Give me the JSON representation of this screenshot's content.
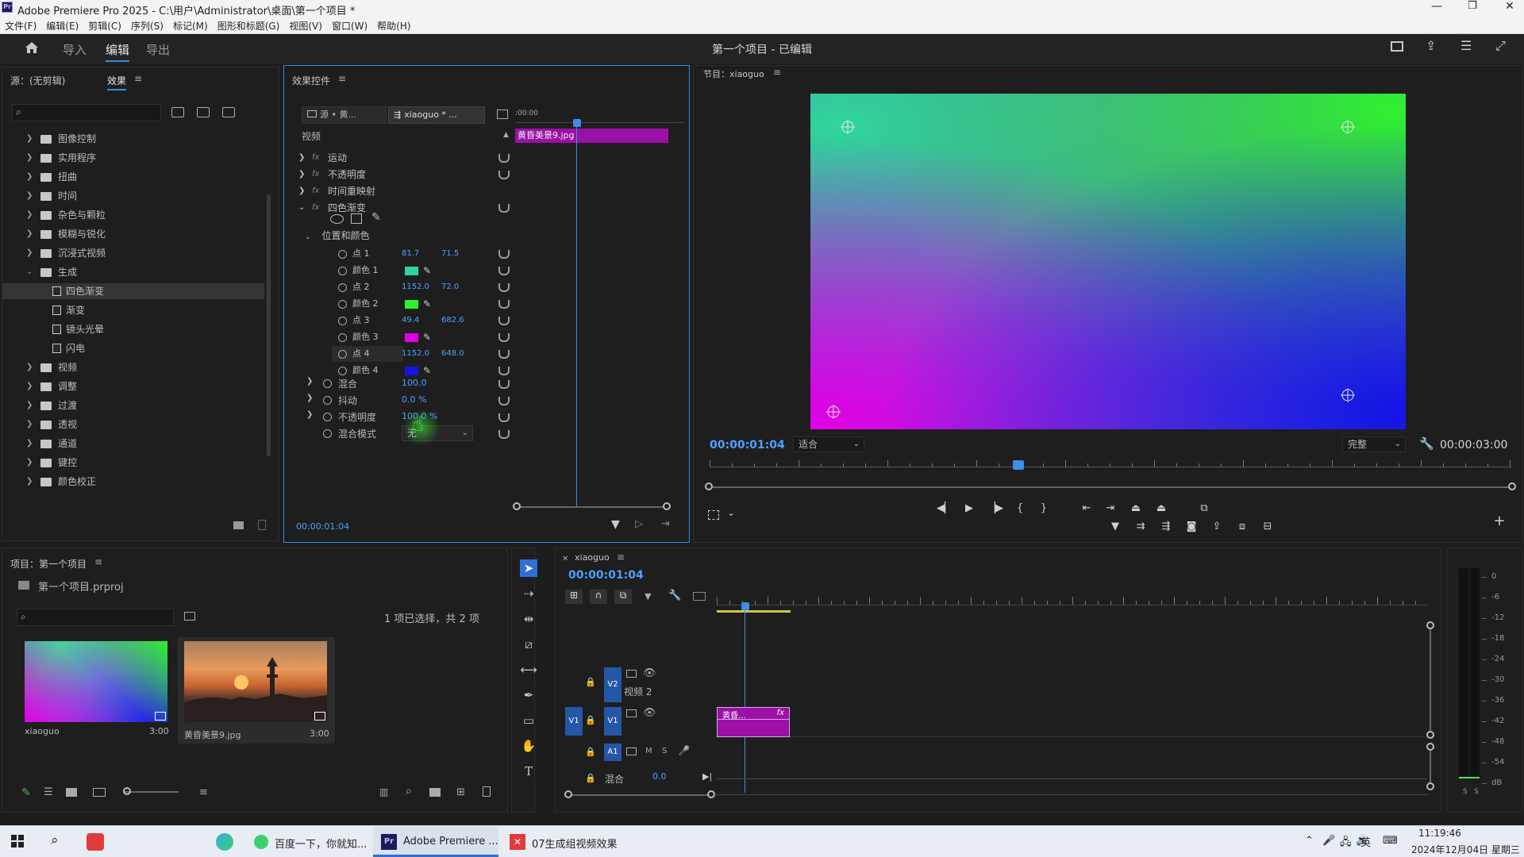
{
  "window": {
    "title": "Adobe Premiere Pro 2025 - C:\\用户\\Administrator\\桌面\\第一个项目 *"
  },
  "menu": [
    "文件(F)",
    "编辑(E)",
    "剪辑(C)",
    "序列(S)",
    "标记(M)",
    "图形和标题(G)",
    "视图(V)",
    "窗口(W)",
    "帮助(H)"
  ],
  "header": {
    "tabs": [
      "导入",
      "编辑",
      "导出"
    ],
    "project_title": "第一个项目 - 已编辑"
  },
  "source_panel": {
    "tab_source": "源：(无剪辑)",
    "tab_effects": "效果",
    "tree": [
      {
        "label": "图像控制",
        "type": "folder",
        "expanded": false,
        "indent": 0
      },
      {
        "label": "实用程序",
        "type": "folder",
        "expanded": false,
        "indent": 0
      },
      {
        "label": "扭曲",
        "type": "folder",
        "expanded": false,
        "indent": 0
      },
      {
        "label": "时间",
        "type": "folder",
        "expanded": false,
        "indent": 0
      },
      {
        "label": "杂色与颗粒",
        "type": "folder",
        "expanded": false,
        "indent": 0
      },
      {
        "label": "模糊与锐化",
        "type": "folder",
        "expanded": false,
        "indent": 0
      },
      {
        "label": "沉浸式视频",
        "type": "folder",
        "expanded": false,
        "indent": 0
      },
      {
        "label": "生成",
        "type": "folder",
        "expanded": true,
        "indent": 0
      },
      {
        "label": "四色渐变",
        "type": "file",
        "indent": 1,
        "selected": true
      },
      {
        "label": "渐变",
        "type": "file",
        "indent": 1
      },
      {
        "label": "镜头光晕",
        "type": "file",
        "indent": 1
      },
      {
        "label": "闪电",
        "type": "file",
        "indent": 1
      },
      {
        "label": "视频",
        "type": "folder",
        "expanded": false,
        "indent": 0
      },
      {
        "label": "调整",
        "type": "folder",
        "expanded": false,
        "indent": 0
      },
      {
        "label": "过渡",
        "type": "folder",
        "expanded": false,
        "indent": 0
      },
      {
        "label": "透视",
        "type": "folder",
        "expanded": false,
        "indent": 0
      },
      {
        "label": "通道",
        "type": "folder",
        "expanded": false,
        "indent": 0
      },
      {
        "label": "键控",
        "type": "folder",
        "expanded": false,
        "indent": 0
      },
      {
        "label": "颜色校正",
        "type": "folder",
        "expanded": false,
        "indent": 0
      }
    ]
  },
  "effect_controls": {
    "title": "效果控件",
    "src_tab": "源 • 黄...",
    "seq_tab": "xiaoguo * ...",
    "section": "视频",
    "ruler_time": ":00:00",
    "clip_label": "黄昏美景9.jpg",
    "effects": [
      "运动",
      "不透明度",
      "时间重映射",
      "四色渐变"
    ],
    "group": "位置和颜色",
    "params": [
      {
        "label": "点 1",
        "v1": "81.7",
        "v2": "71.5"
      },
      {
        "label": "颜色 1",
        "color": "#2fd69b"
      },
      {
        "label": "点 2",
        "v1": "1152.0",
        "v2": "72.0"
      },
      {
        "label": "颜色 2",
        "color": "#2ef12e"
      },
      {
        "label": "点 3",
        "v1": "49.4",
        "v2": "682.6"
      },
      {
        "label": "颜色 3",
        "color": "#e100e6"
      },
      {
        "label": "点 4",
        "v1": "1152.0",
        "v2": "648.0"
      },
      {
        "label": "颜色 4",
        "color": "#1414e6"
      }
    ],
    "blend_label": "混合",
    "blend_value": "100.0",
    "jitter_label": "抖动",
    "jitter_value": "0.0 %",
    "opacity_label": "不透明度",
    "opacity_value": "100.0 %",
    "blendmode_label": "混合模式",
    "blendmode_value": "无",
    "timecode": "00:00:01:04"
  },
  "program": {
    "title": "节目：xiaoguo",
    "timecode": "00:00:01:04",
    "fit": "适合",
    "quality": "完整",
    "duration": "00:00:03:00"
  },
  "project": {
    "title": "项目：第一个项目",
    "file": "第一个项目.prproj",
    "selection": "1 项已选择，共 2 项",
    "items": [
      {
        "name": "xiaoguo",
        "duration": "3:00"
      },
      {
        "name": "黄昏美景9.jpg",
        "duration": "3:00"
      }
    ]
  },
  "timeline": {
    "title": "xiaoguo",
    "timecode": "00:00:01:04",
    "tracks": [
      {
        "id": "V2",
        "name": "视频 2"
      },
      {
        "id": "V1",
        "name": ""
      },
      {
        "id": "A1",
        "name": ""
      }
    ],
    "source_v1": "V1",
    "mix_label": "混合",
    "mix_value": "0.0",
    "clip_label": "黄昏...",
    "fx_badge": "fx",
    "meter_labels": [
      "0",
      "-6",
      "-12",
      "-18",
      "-24",
      "-30",
      "-36",
      "-42",
      "-48",
      "-54",
      "dB"
    ],
    "meter_foot": [
      "S",
      "S"
    ]
  },
  "taskbar": {
    "apps": [
      {
        "label": "百度一下，你就知..."
      },
      {
        "label": "Adobe Premiere ..."
      },
      {
        "label": "07生成组视频效果"
      }
    ],
    "ime": "英",
    "time": "11:19:46",
    "date": "2024年12月04日 星期三"
  },
  "colors": {
    "accent": "#2d8ceb",
    "timecode": "#4ea0ff",
    "clip": "#9b10a6",
    "playhead": "#3b8fe6"
  }
}
